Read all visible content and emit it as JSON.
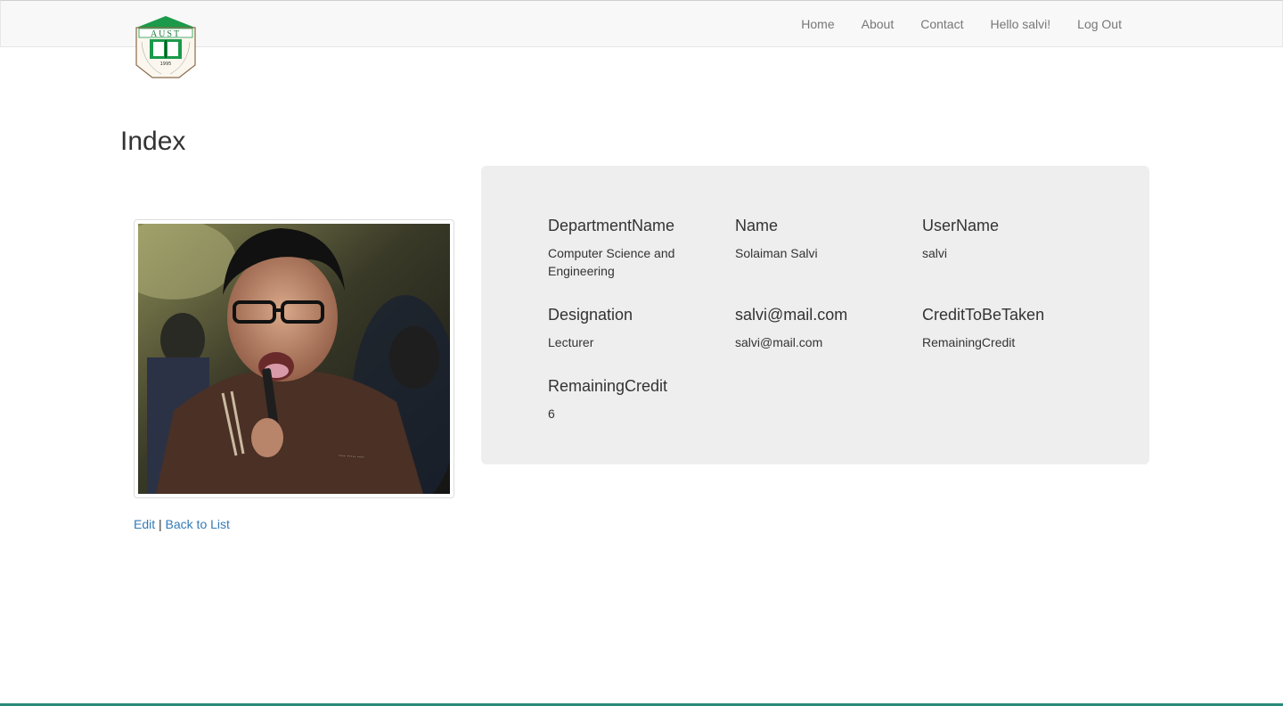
{
  "navbar": {
    "logo_text": "AUST",
    "logo_year": "1995",
    "links": [
      "Home",
      "About",
      "Contact",
      "Hello salvi!",
      "Log Out"
    ]
  },
  "page": {
    "title": "Index"
  },
  "details": [
    {
      "label": "DepartmentName",
      "value": "Computer Science and Engineering"
    },
    {
      "label": "Name",
      "value": "Solaiman Salvi"
    },
    {
      "label": "UserName",
      "value": "salvi"
    },
    {
      "label": "Designation",
      "value": "Lecturer"
    },
    {
      "label": "salvi@mail.com",
      "value": "salvi@mail.com"
    },
    {
      "label": "CreditToBeTaken",
      "value": "RemainingCredit"
    },
    {
      "label": "RemainingCredit",
      "value": "6"
    }
  ],
  "actions": {
    "edit": "Edit",
    "separator": "|",
    "back": "Back to List"
  },
  "colors": {
    "link": "#337ab7",
    "navbar_bg": "#f8f8f8",
    "panel_bg": "#eeeeee",
    "logo_green": "#1a9a4a"
  }
}
